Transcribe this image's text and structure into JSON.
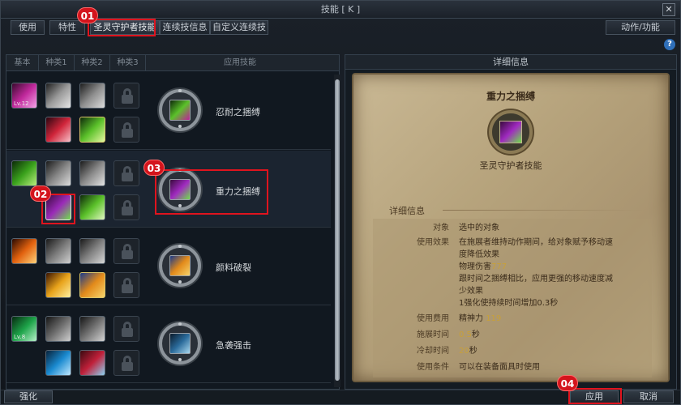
{
  "window": {
    "title": "技能 [ K ]",
    "close_label": "✕"
  },
  "tabs": [
    {
      "label": "使用"
    },
    {
      "label": "特性"
    },
    {
      "label": "圣灵守护者技能"
    },
    {
      "label": "连续技信息"
    },
    {
      "label": "自定义连续技"
    }
  ],
  "action_tab": "动作/功能",
  "help": "?",
  "columns": [
    "基本",
    "种类1",
    "种类2",
    "种类3",
    "应用技能"
  ],
  "skills": [
    {
      "name": "忍耐之捆缚",
      "base_level": "Lv.12"
    },
    {
      "name": "重力之捆缚",
      "base_level": ""
    },
    {
      "name": "颜料破裂",
      "base_level": ""
    },
    {
      "name": "急袭强击",
      "base_level": "Lv.8"
    }
  ],
  "detail": {
    "header": "详细信息",
    "skill_name": "重力之捆缚",
    "skill_type": "圣灵守护者技能",
    "section_title": "详细信息",
    "rows": [
      {
        "label": "对象",
        "value": "选中的对象"
      },
      {
        "label": "使用效果",
        "lines": [
          "在施展者维持动作期间，给对象赋予移动速",
          "度降低效果",
          "物理伤害",
          "跟时间之捆缚相比，应用更强的移动速度减",
          "少效果",
          "1强化使持续时间增加0.3秒"
        ],
        "damage": "777"
      },
      {
        "label": "使用费用",
        "value": "精神力",
        "amount": "119"
      },
      {
        "label": "施展时间",
        "amount": "0.5",
        "unit": "秒"
      },
      {
        "label": "冷却时间",
        "amount": "20",
        "unit": "秒"
      },
      {
        "label": "使用条件",
        "value": "可以在装备面具时使用"
      }
    ]
  },
  "bottom": {
    "enhance": "强化",
    "apply": "应用",
    "cancel": "取消"
  },
  "callouts": [
    "01",
    "02",
    "03",
    "04"
  ],
  "colors": {
    "callout": "#e0141e",
    "highlight": "#c7a03a"
  }
}
